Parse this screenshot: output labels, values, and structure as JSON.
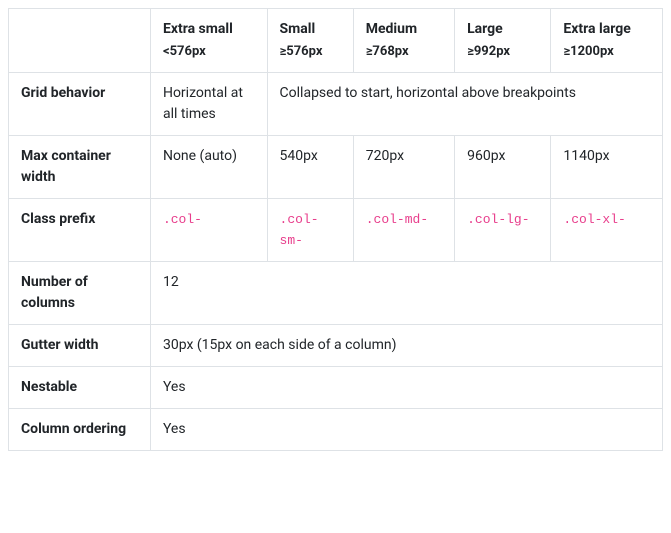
{
  "head": {
    "xs": {
      "label": "Extra small",
      "cond": "<576px"
    },
    "sm": {
      "label": "Small",
      "cond": "≥576px"
    },
    "md": {
      "label": "Medium",
      "cond": "≥768px"
    },
    "lg": {
      "label": "Large",
      "cond": "≥992px"
    },
    "xl": {
      "label": "Extra large",
      "cond": "≥1200px"
    }
  },
  "rows": {
    "grid_behavior": {
      "label": "Grid behavior",
      "xs": "Horizontal at all times",
      "rest": "Collapsed to start, horizontal above breakpoints"
    },
    "max_width": {
      "label": "Max container width",
      "xs": "None (auto)",
      "sm": "540px",
      "md": "720px",
      "lg": "960px",
      "xl": "1140px"
    },
    "class_prefix": {
      "label": "Class prefix",
      "xs": ".col-",
      "sm": ".col-sm-",
      "md": ".col-md-",
      "lg": ".col-lg-",
      "xl": ".col-xl-"
    },
    "num_columns": {
      "label": "Number of columns",
      "value": "12"
    },
    "gutter_width": {
      "label": "Gutter width",
      "value": "30px (15px on each side of a column)"
    },
    "nestable": {
      "label": "Nestable",
      "value": "Yes"
    },
    "column_ordering": {
      "label": "Column ordering",
      "value": "Yes"
    }
  }
}
